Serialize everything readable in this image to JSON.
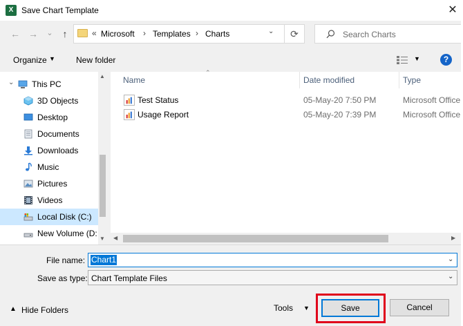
{
  "window": {
    "title": "Save Chart Template",
    "app_icon_letter": "X",
    "close_glyph": "✕"
  },
  "nav": {
    "back": "←",
    "forward": "→",
    "recent": "⌄",
    "up": "↑"
  },
  "address": {
    "overflow": "«",
    "separator": "›",
    "crumbs": [
      "Microsoft",
      "Templates",
      "Charts"
    ],
    "refresh": "⟳"
  },
  "search": {
    "placeholder": "Search Charts"
  },
  "toolbar": {
    "organize_label": "Organize",
    "new_folder_label": "New folder",
    "help_label": "?"
  },
  "navpane": {
    "items": [
      {
        "label": "This PC"
      },
      {
        "label": "3D Objects"
      },
      {
        "label": "Desktop"
      },
      {
        "label": "Documents"
      },
      {
        "label": "Downloads"
      },
      {
        "label": "Music"
      },
      {
        "label": "Pictures"
      },
      {
        "label": "Videos"
      },
      {
        "label": "Local Disk (C:)",
        "selected": true
      },
      {
        "label": "New Volume (D:"
      }
    ]
  },
  "file_list": {
    "columns": [
      "Name",
      "Date modified",
      "Type"
    ],
    "rows": [
      {
        "name": "Test Status",
        "date": "05-May-20 7:50 PM",
        "type": "Microsoft Office"
      },
      {
        "name": "Usage Report",
        "date": "05-May-20 7:39 PM",
        "type": "Microsoft Office"
      }
    ]
  },
  "form": {
    "filename_label": "File name:",
    "filename_value": "Chart1",
    "savetype_label": "Save as type:",
    "savetype_value": "Chart Template Files"
  },
  "footer": {
    "hide_folders_label": "Hide Folders",
    "tools_label": "Tools",
    "save_label": "Save",
    "cancel_label": "Cancel"
  },
  "colors": {
    "accent": "#0078d7",
    "highlight": "#e0001b",
    "selected_nav": "#cce8ff",
    "excel_green": "#1d6f42"
  }
}
